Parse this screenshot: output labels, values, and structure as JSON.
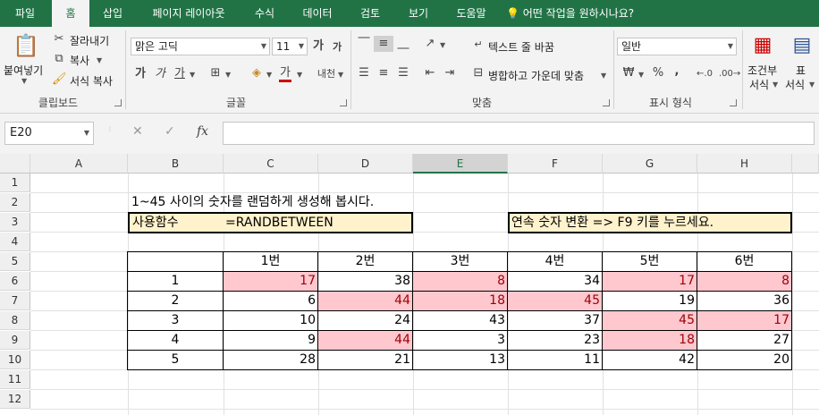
{
  "tabs": [
    "파일",
    "홈",
    "삽입",
    "페이지 레이아웃",
    "수식",
    "데이터",
    "검토",
    "보기",
    "도움말",
    "어떤 작업을 원하시나요?"
  ],
  "ribbon": {
    "clipboard": {
      "paste": "붙여넣기",
      "cut": "잘라내기",
      "copy": "복사",
      "format_painter": "서식 복사",
      "label": "클립보드"
    },
    "font": {
      "name": "맑은 고딕",
      "size": "11",
      "label": "글꼴",
      "grow": "가",
      "shrink": "가",
      "bold": "가",
      "italic": "가",
      "underline": "가",
      "font_color": "가",
      "phonetic": "내천"
    },
    "alignment": {
      "wrap": "텍스트 줄 바꿈",
      "merge": "병합하고 가운데 맞춤",
      "label": "맞춤"
    },
    "number": {
      "format": "일반",
      "percent": "%",
      "comma": ",",
      "label": "표시 형식"
    },
    "styles": {
      "conditional_1": "조건부",
      "conditional_2": "서식",
      "table_1": "표",
      "table_2": "서식"
    }
  },
  "formula_bar": {
    "name_box": "E20",
    "cancel": "✕",
    "enter": "✓",
    "fx": "fx",
    "content": ""
  },
  "sheet": {
    "columns": [
      "A",
      "B",
      "C",
      "D",
      "E",
      "F",
      "G",
      "H"
    ],
    "rows": [
      "1",
      "2",
      "3",
      "4",
      "5",
      "6",
      "7",
      "8",
      "9",
      "10",
      "11",
      "12"
    ],
    "selected_column": "E",
    "b2": "1~45 사이의 숫자를 랜덤하게 생성해 봅시다.",
    "b3_label": "사용함수",
    "b3_value": "=RANDBETWEEN",
    "f3": "연속 숫자 변환 => F9 키를 누르세요.",
    "table_headers": [
      "",
      "1번",
      "2번",
      "3번",
      "4번",
      "5번",
      "6번"
    ],
    "table_rows": [
      {
        "idx": "1",
        "values": [
          "17",
          "38",
          "8",
          "34",
          "17",
          "8"
        ],
        "highlight": [
          true,
          false,
          true,
          false,
          true,
          true
        ]
      },
      {
        "idx": "2",
        "values": [
          "6",
          "44",
          "18",
          "45",
          "19",
          "36"
        ],
        "highlight": [
          false,
          true,
          true,
          true,
          false,
          false
        ]
      },
      {
        "idx": "3",
        "values": [
          "10",
          "24",
          "43",
          "37",
          "45",
          "17"
        ],
        "highlight": [
          false,
          false,
          false,
          false,
          true,
          true
        ]
      },
      {
        "idx": "4",
        "values": [
          "9",
          "44",
          "3",
          "23",
          "18",
          "27"
        ],
        "highlight": [
          false,
          true,
          false,
          false,
          true,
          false
        ]
      },
      {
        "idx": "5",
        "values": [
          "28",
          "21",
          "13",
          "11",
          "42",
          "20"
        ],
        "highlight": [
          false,
          false,
          false,
          false,
          false,
          false
        ]
      }
    ]
  },
  "colors": {
    "accent": "#217346",
    "highlight_fill": "#ffc7ce",
    "highlight_text": "#9c0006",
    "box_fill": "#fff2cc"
  }
}
